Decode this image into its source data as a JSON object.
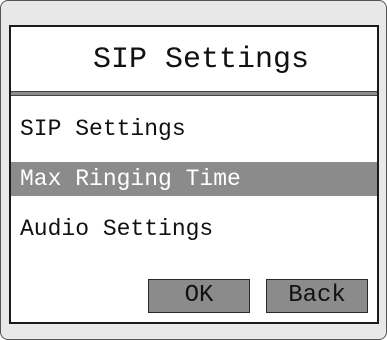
{
  "screen": {
    "title": "SIP Settings"
  },
  "menu": {
    "items": [
      {
        "label": "SIP Settings",
        "selected": false
      },
      {
        "label": "Max Ringing Time",
        "selected": true
      },
      {
        "label": "Audio Settings",
        "selected": false
      }
    ]
  },
  "softkeys": {
    "ok_label": "OK",
    "back_label": "Back"
  },
  "colors": {
    "selection_bg": "#8b8b8b",
    "selection_text": "#ffffff",
    "button_bg": "#8b8b8b",
    "screen_bg": "#ffffff",
    "bezel_bg": "#e8e8e8"
  }
}
